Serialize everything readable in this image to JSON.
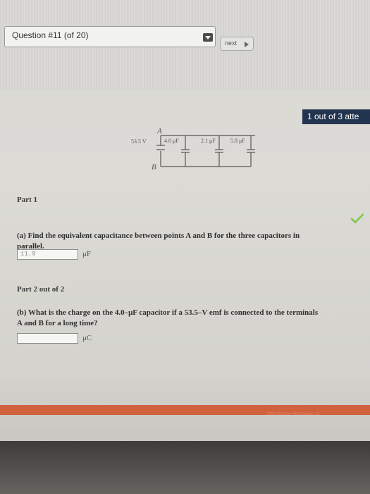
{
  "header": {
    "question_selector": "Question #11 (of 20)",
    "next_label": "next"
  },
  "attempts": "1 out of 3 atte",
  "circuit": {
    "point_a": "A",
    "point_b": "B",
    "emf": "53.5 V",
    "capacitors": [
      "4.0 μF",
      "2.1 μF",
      "5.8 μF"
    ]
  },
  "part1": {
    "heading": "Part 1",
    "question_line1": "(a) Find the equivalent capacitance between points A and B for the three capacitors in",
    "question_line2": "parallel.",
    "answer_value": "11.9",
    "unit": "μF",
    "status": "correct"
  },
  "part2": {
    "heading": "Part 2 out of 2",
    "question_line1": "(b) What is the charge on the 4.0–μF capacitor if a 53.5–V emf is connected to the terminals",
    "question_line2": "A and B for a long time?",
    "answer_value": "",
    "unit": "μC"
  },
  "footer": {
    "copyright": "©2013 McGraw-Hill Education. All"
  },
  "colors": {
    "badge": "#23344f",
    "check": "#7cc84a",
    "footer_bar": "#d0623e"
  }
}
